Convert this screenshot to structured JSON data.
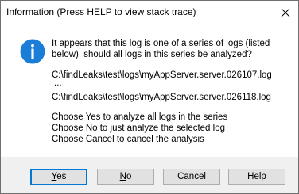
{
  "window": {
    "title": "Information (Press HELP to view stack trace)",
    "close_glyph": "✕"
  },
  "message": {
    "icon": "information-icon",
    "line1": "It appears that this log is one of a series of logs (listed",
    "line2": "below), should all logs in this series be analyzed?",
    "log_first": "C:\\findLeaks\\test\\logs\\myAppServer.server.026107.log",
    "ellipsis": "...",
    "log_last": "C:\\findLeaks\\test\\logs\\myAppServer.server.026118.log",
    "choice_yes": "Choose Yes to analyze all logs in the series",
    "choice_no": "Choose No to just analyze the selected log",
    "choice_cancel": "Choose Cancel to cancel the analysis"
  },
  "buttons": {
    "yes_mnemonic": "Y",
    "yes_rest": "es",
    "no_mnemonic": "N",
    "no_rest": "o",
    "cancel": "Cancel",
    "help": "Help"
  },
  "colors": {
    "icon_blue": "#1a7dd7",
    "default_button_border": "#0078d7",
    "footer_bg": "#f0f0f0"
  }
}
